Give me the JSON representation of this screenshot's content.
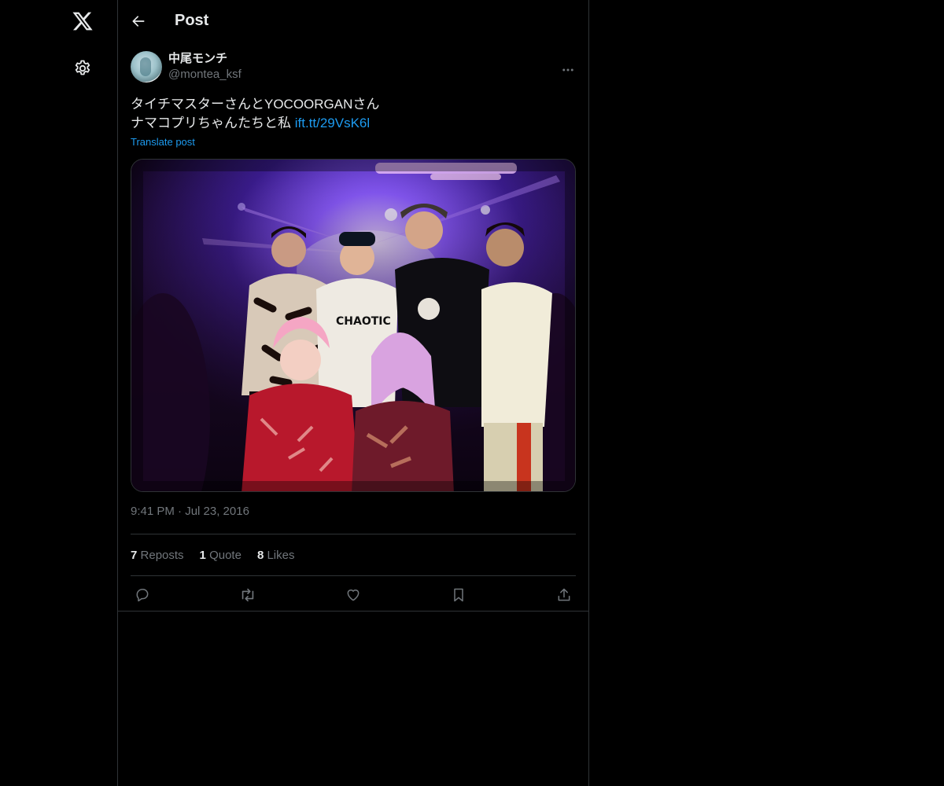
{
  "nav": {
    "logo_icon": "x-logo-icon",
    "settings_icon": "gear-icon"
  },
  "header": {
    "back_icon": "arrow-left-icon",
    "title": "Post"
  },
  "post": {
    "author": {
      "display_name": "中尾モンチ",
      "handle": "@montea_ksf"
    },
    "text_line1": "タイチマスターさんとYOCOORGANさん",
    "text_line2": "ナマコプリちゃんたちと私 ",
    "link": "ift.tt/29VsK6l",
    "translate_label": "Translate post",
    "timestamp": "9:41 PM · Jul 23, 2016",
    "stats": {
      "reposts_count": "7",
      "reposts_label": "Reposts",
      "quotes_count": "1",
      "quotes_label": "Quote",
      "likes_count": "8",
      "likes_label": "Likes"
    },
    "actions": [
      "reply-icon",
      "repost-icon",
      "like-icon",
      "bookmark-icon",
      "share-icon"
    ]
  },
  "colors": {
    "background": "#000000",
    "text_primary": "#e7e9ea",
    "text_secondary": "#71767b",
    "link": "#1d9bf0",
    "border": "#2f3336"
  }
}
